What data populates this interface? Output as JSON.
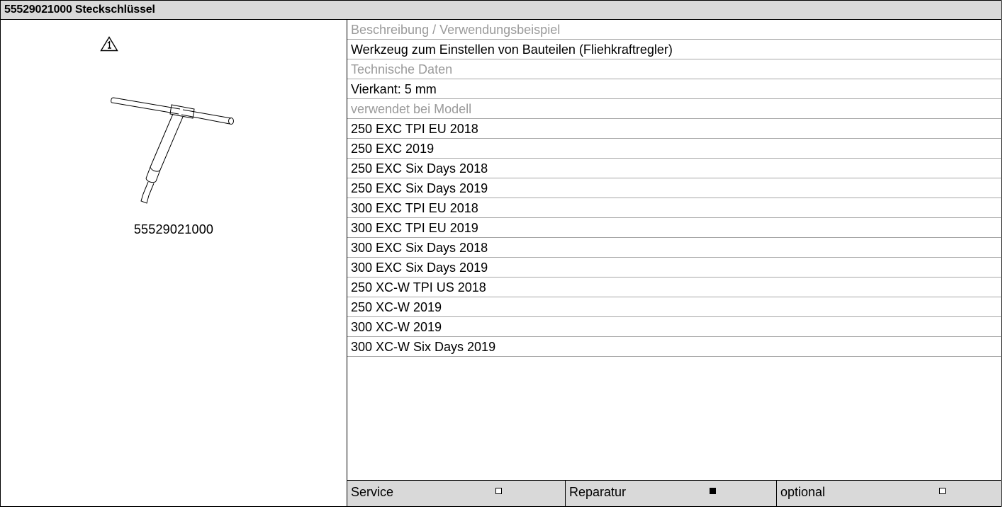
{
  "header": {
    "title": "55529021000 Steckschlüssel"
  },
  "left": {
    "part_number": "55529021000"
  },
  "details": {
    "description_label": "Beschreibung / Verwendungsbeispiel",
    "description": "Werkzeug zum Einstellen von Bauteilen (Fliehkraftregler)",
    "tech_label": "Technische Daten",
    "tech": "Vierkant: 5 mm",
    "models_label": "verwendet bei Modell",
    "models": [
      "250 EXC TPI EU 2018",
      "250 EXC 2019",
      "250 EXC Six Days 2018",
      "250 EXC Six Days 2019",
      "300 EXC TPI EU 2018",
      "300 EXC TPI EU 2019",
      "300 EXC Six Days 2018",
      "300 EXC Six Days 2019",
      "250 XC-W TPI US 2018",
      "250 XC-W 2019",
      "300 XC-W 2019",
      "300 XC-W Six Days 2019"
    ]
  },
  "footer": {
    "service_label": "Service",
    "service_checked": false,
    "repair_label": "Reparatur",
    "repair_checked": true,
    "optional_label": "optional",
    "optional_checked": false
  }
}
